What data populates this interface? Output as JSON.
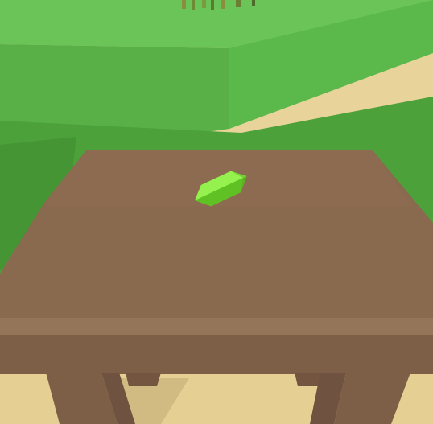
{
  "scene": {
    "view": "first-person",
    "objects": [
      {
        "name": "grass-block-upper",
        "color": "#5fb84a"
      },
      {
        "name": "grass-block-left",
        "color": "#4ea43b"
      },
      {
        "name": "table",
        "color": "#8a6a4f"
      },
      {
        "name": "green-crystal",
        "color": "#7ee034"
      },
      {
        "name": "sand-ground",
        "color": "#e6cf92"
      }
    ]
  },
  "colors": {
    "grass_top": "#64bd4f",
    "grass_side": "#4c9f3a",
    "grass_shade": "#3f8c31",
    "table_top": "#8a6a4f",
    "table_edge": "#7b5e45",
    "table_leg": "#705440",
    "crystal_light": "#93f34c",
    "crystal_mid": "#7ee034",
    "crystal_dark": "#5fbf22",
    "sand": "#e6cf92",
    "sand_shadow": "#c9b27d"
  }
}
